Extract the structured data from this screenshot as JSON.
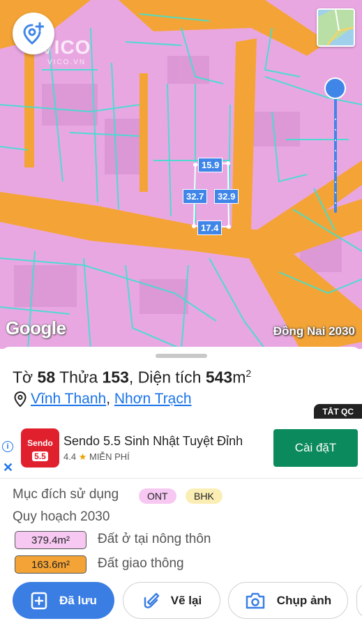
{
  "map": {
    "watermark": "VICO",
    "watermark_sub": "VICO.VN",
    "google_logo": "Google",
    "planning_layer": "Đồng Nai 2030",
    "dimensions": {
      "top": "15.9",
      "left": "32.7",
      "right": "32.9",
      "bottom": "17.4"
    },
    "add_pin_icon": "add-location-icon",
    "minimap_icon": "minimap-thumbnail",
    "colors": {
      "residential": "#e9a7e2",
      "road": "#f4a436",
      "parcel_line": "#3ee0d0",
      "accent": "#3f86e8"
    }
  },
  "plot": {
    "sheet_label": "Tờ",
    "sheet_no": "58",
    "parcel_label": "Thửa",
    "parcel_no": "153",
    "area_label": "Diện tích",
    "area_value": "543",
    "area_unit": "m",
    "area_exp": "2",
    "commune": "Vĩnh Thanh",
    "separator": ",",
    "district": "Nhơn Trạch"
  },
  "ad": {
    "tag": "TẮT QC",
    "app_name": "Sendo 5.5 Sinh Nhật Tuyệt Đỉnh",
    "rating": "4.4",
    "price": "MIỄN PHÍ",
    "install": "Cài đặT",
    "logo_line1": "Sendo",
    "logo_line2": "5.5",
    "info": "i",
    "close": "✕"
  },
  "land_use": {
    "purpose_label": "Mục đích sử dụng",
    "codes": [
      {
        "code": "ONT",
        "color": "#f6c8f2"
      },
      {
        "code": "BHK",
        "color": "#fbeeb5"
      }
    ],
    "plan_label": "Quy hoạch 2030",
    "zones": [
      {
        "area": "379.4m²",
        "name": "Đất ở tại nông thôn",
        "color": "#f6c8f2"
      },
      {
        "area": "163.6m²",
        "name": "Đất giao thông",
        "color": "#f4a436"
      }
    ]
  },
  "actions": {
    "saved": "Đã lưu",
    "redraw": "Vẽ lại",
    "photo": "Chụp ảnh"
  }
}
